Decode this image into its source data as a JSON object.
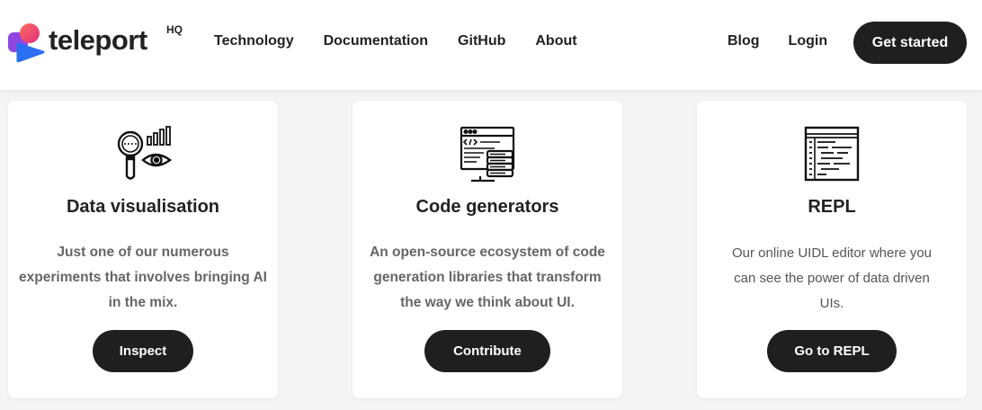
{
  "header": {
    "logo_word": "teleport",
    "logo_hq": "HQ",
    "nav": [
      "Technology",
      "Documentation",
      "GitHub",
      "About"
    ],
    "nav_right": [
      "Blog",
      "Login"
    ],
    "cta": "Get started"
  },
  "cards": [
    {
      "icon": "magnifier-eye-chart-icon",
      "title": "Data visualisation",
      "description": "Just one of our numerous experiments that involves bringing AI in the mix.",
      "button": "Inspect"
    },
    {
      "icon": "code-window-database-icon",
      "title": "Code generators",
      "description": "An open-source ecosystem of code generation libraries that transform the way we think about UI.",
      "button": "Contribute"
    },
    {
      "icon": "code-editor-icon",
      "title": "REPL",
      "description": "Our online UIDL editor where you can see the power of data driven UIs.",
      "button": "Go to REPL"
    }
  ],
  "colors": {
    "background": "#f4f4f4",
    "card": "#ffffff",
    "button": "#1f1f1f",
    "logo_pink": "#e83f7a",
    "logo_purple": "#8f45e0",
    "logo_blue": "#2a6ff2"
  }
}
